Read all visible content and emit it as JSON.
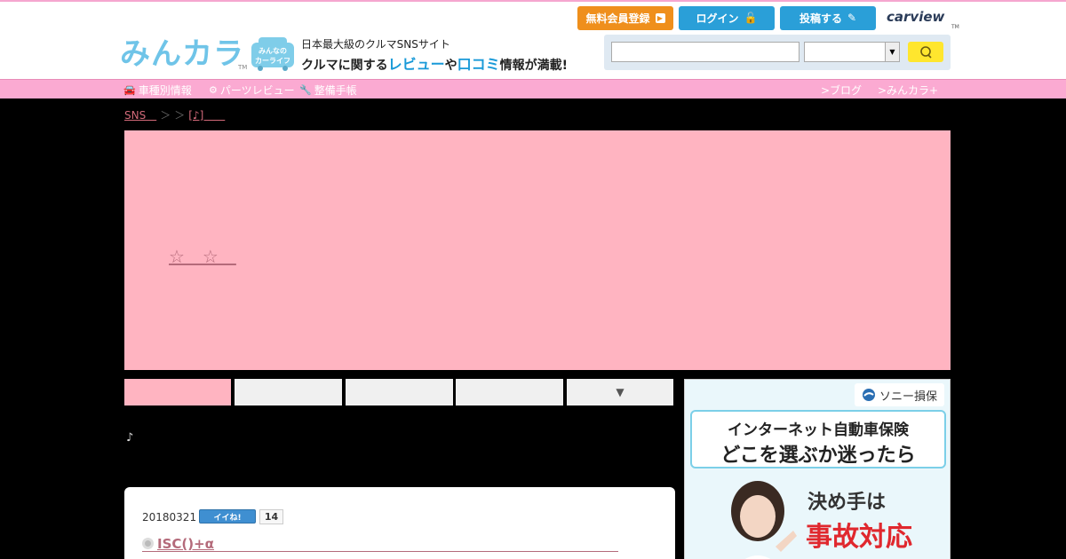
{
  "header": {
    "logo_text": "みんカラ",
    "logo_tm": "TM",
    "badge_line1": "みんなの",
    "badge_line2": "カーライフ",
    "tagline1": "日本最大級のクルマSNSサイト",
    "tagline2_a": "クルマに関する",
    "tagline2_b": "レビュー",
    "tagline2_c": "や",
    "tagline2_d": "口コミ",
    "tagline2_e": "情報が満載!",
    "buttons": {
      "register": "無料会員登録",
      "login": "ログイン",
      "post": "投稿する"
    },
    "carview": "carview",
    "carview_tm": "TM",
    "search": {
      "value": "",
      "select_value": ""
    }
  },
  "nav": {
    "items": [
      {
        "label": "車種別情報",
        "icon": "car-icon"
      },
      {
        "label": "パーツレビュー",
        "icon": "parts-icon"
      },
      {
        "label": "整備手帳",
        "icon": "wrench-icon"
      }
    ],
    "right": [
      {
        "label": ">ブログ"
      },
      {
        "label": ">みんカラ+"
      }
    ]
  },
  "breadcrumb": {
    "items": [
      "SNS　",
      "＞",
      "＞",
      "[♪]　　"
    ]
  },
  "hero": {
    "title": "☆　☆　"
  },
  "tabs": {
    "items": [
      "",
      "",
      "",
      "",
      "▼"
    ]
  },
  "note": "♪",
  "post": {
    "date": "20180321",
    "iine_label": "イイね!",
    "count": "14",
    "title": "ISC()+α"
  },
  "ad": {
    "brand": "ソニー損保",
    "line1": "インターネット自動車保険",
    "line2": "どこを選ぶか迷ったら",
    "line3": "決め手は",
    "line4": "事故対応"
  },
  "colors": {
    "accent_pink": "#fbaad2",
    "hero_pink": "#ffb4c1",
    "blue_button": "#2a9fd8",
    "orange_button": "#ef8f1c",
    "link": "#b46a7a"
  }
}
